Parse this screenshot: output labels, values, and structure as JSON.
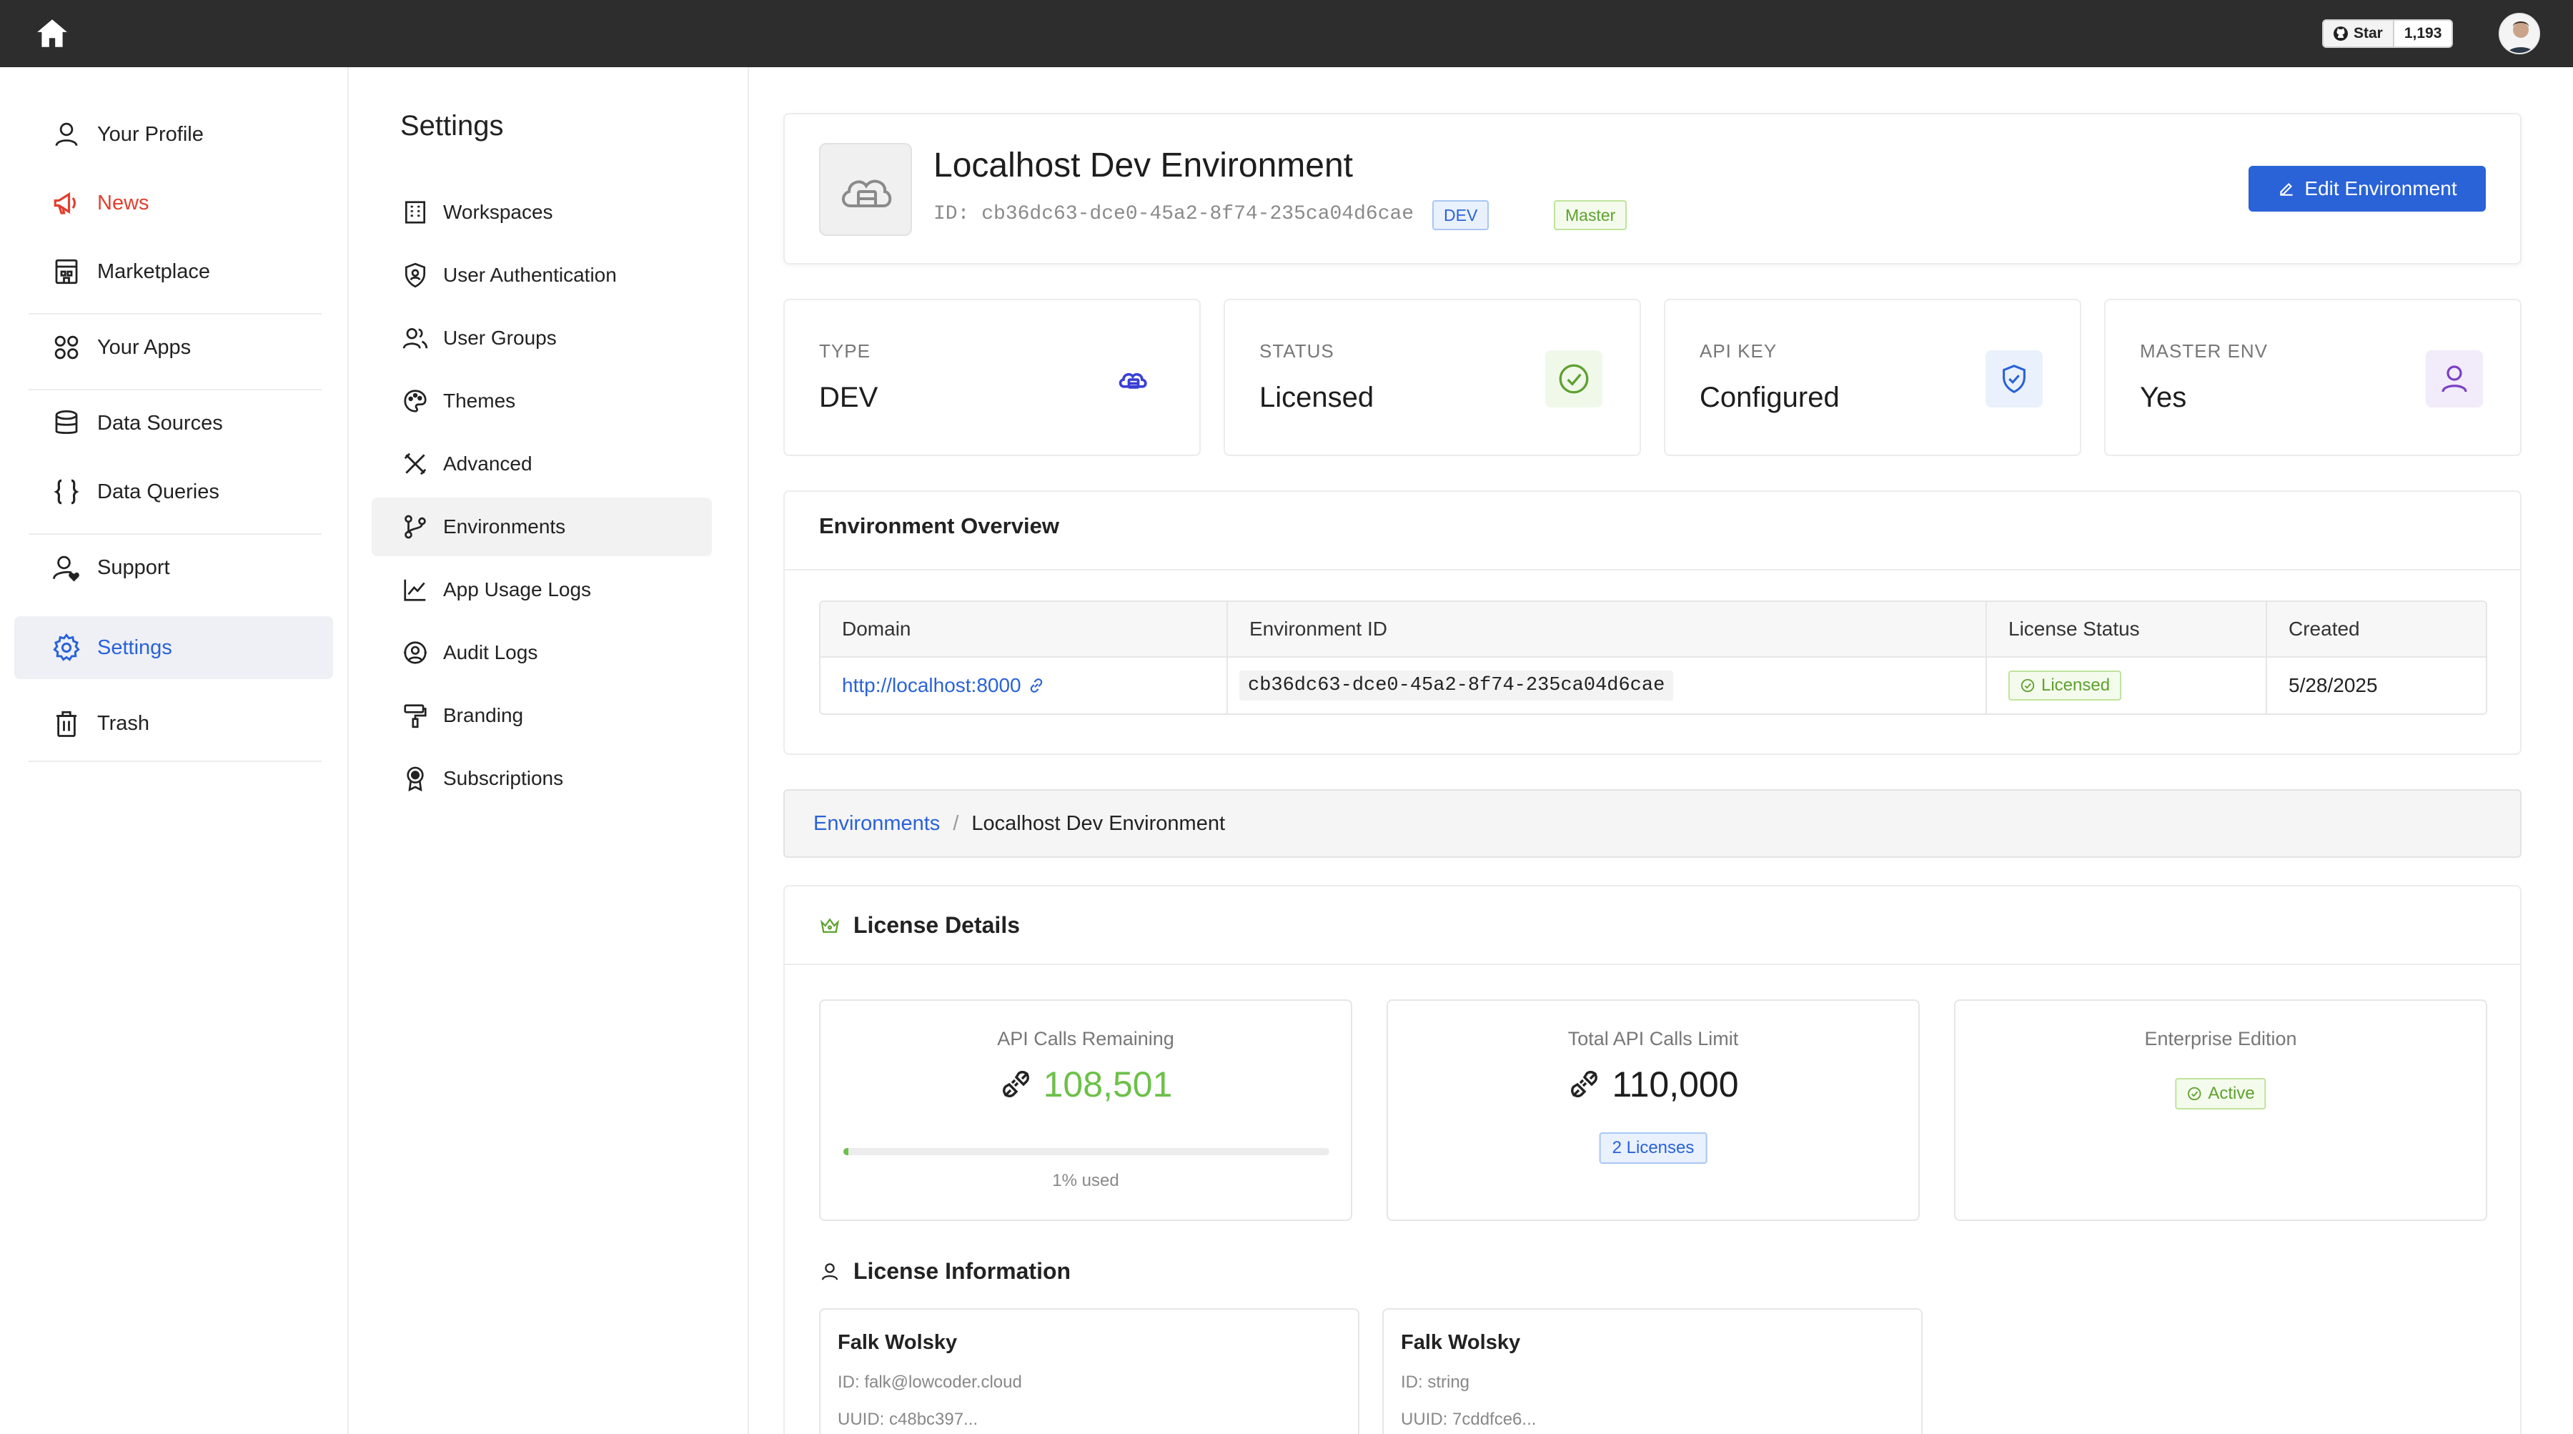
{
  "topbar": {
    "github_star_label": "Star",
    "github_star_count": "1,193"
  },
  "sidebar": {
    "items": [
      {
        "label": "Your Profile",
        "icon": "user-icon"
      },
      {
        "label": "News",
        "icon": "megaphone-icon"
      },
      {
        "label": "Marketplace",
        "icon": "store-icon"
      },
      {
        "label": "Your Apps",
        "icon": "apps-grid-icon"
      },
      {
        "label": "Data Sources",
        "icon": "database-icon"
      },
      {
        "label": "Data Queries",
        "icon": "braces-icon"
      },
      {
        "label": "Support",
        "icon": "support-user-icon"
      },
      {
        "label": "Settings",
        "icon": "gear-icon"
      },
      {
        "label": "Trash",
        "icon": "trash-icon"
      }
    ]
  },
  "settings_nav": {
    "title": "Settings",
    "items": [
      {
        "label": "Workspaces",
        "icon": "building-icon"
      },
      {
        "label": "User Authentication",
        "icon": "shield-user-icon"
      },
      {
        "label": "User Groups",
        "icon": "users-icon"
      },
      {
        "label": "Themes",
        "icon": "palette-icon"
      },
      {
        "label": "Advanced",
        "icon": "tools-icon"
      },
      {
        "label": "Environments",
        "icon": "branch-icon"
      },
      {
        "label": "App Usage Logs",
        "icon": "line-chart-icon"
      },
      {
        "label": "Audit Logs",
        "icon": "audit-icon"
      },
      {
        "label": "Branding",
        "icon": "paint-roller-icon"
      },
      {
        "label": "Subscriptions",
        "icon": "award-icon"
      }
    ]
  },
  "environment": {
    "title": "Localhost Dev Environment",
    "id_line": "ID: cb36dc63-dce0-45a2-8f74-235ca04d6cae",
    "type_tag": "DEV",
    "master_tag": "Master",
    "edit_button": "Edit Environment"
  },
  "stats": [
    {
      "label": "TYPE",
      "value": "DEV",
      "icon": "cloud-server-icon",
      "color": "#3a3fd4"
    },
    {
      "label": "STATUS",
      "value": "Licensed",
      "icon": "check-circle-icon",
      "color": "#5ea12f"
    },
    {
      "label": "API KEY",
      "value": "Configured",
      "icon": "shield-check-icon",
      "color": "#2a62d8"
    },
    {
      "label": "MASTER ENV",
      "value": "Yes",
      "icon": "user-icon",
      "color": "#7b3fc4"
    }
  ],
  "overview": {
    "title": "Environment Overview",
    "headers": [
      "Domain",
      "Environment ID",
      "License Status",
      "Created"
    ],
    "row": {
      "domain": "http://localhost:8000",
      "environment_id": "cb36dc63-dce0-45a2-8f74-235ca04d6cae",
      "license_status": "Licensed",
      "created": "5/28/2025"
    }
  },
  "breadcrumb": {
    "parent": "Environments",
    "separator": "/",
    "current": "Localhost Dev Environment"
  },
  "license": {
    "title": "License Details",
    "api_calls_remaining": {
      "label": "API Calls Remaining",
      "value": "108,501",
      "used_fraction": 0.01,
      "used_text": "1% used"
    },
    "total_api_calls": {
      "label": "Total API Calls Limit",
      "value": "110,000",
      "badge": "2 Licenses"
    },
    "enterprise": {
      "label": "Enterprise Edition",
      "badge": "Active"
    },
    "info_title": "License Information",
    "people": [
      {
        "name": "Falk Wolsky",
        "id": "ID: falk@lowcoder.cloud",
        "uuid": "UUID: c48bc397..."
      },
      {
        "name": "Falk Wolsky",
        "id": "ID: string",
        "uuid": "UUID: 7cddfce6..."
      }
    ]
  },
  "colors": {
    "accent": "#2a62d8",
    "success": "#6dc04a",
    "danger": "#e2402e",
    "topbar": "#2d2d2d"
  }
}
